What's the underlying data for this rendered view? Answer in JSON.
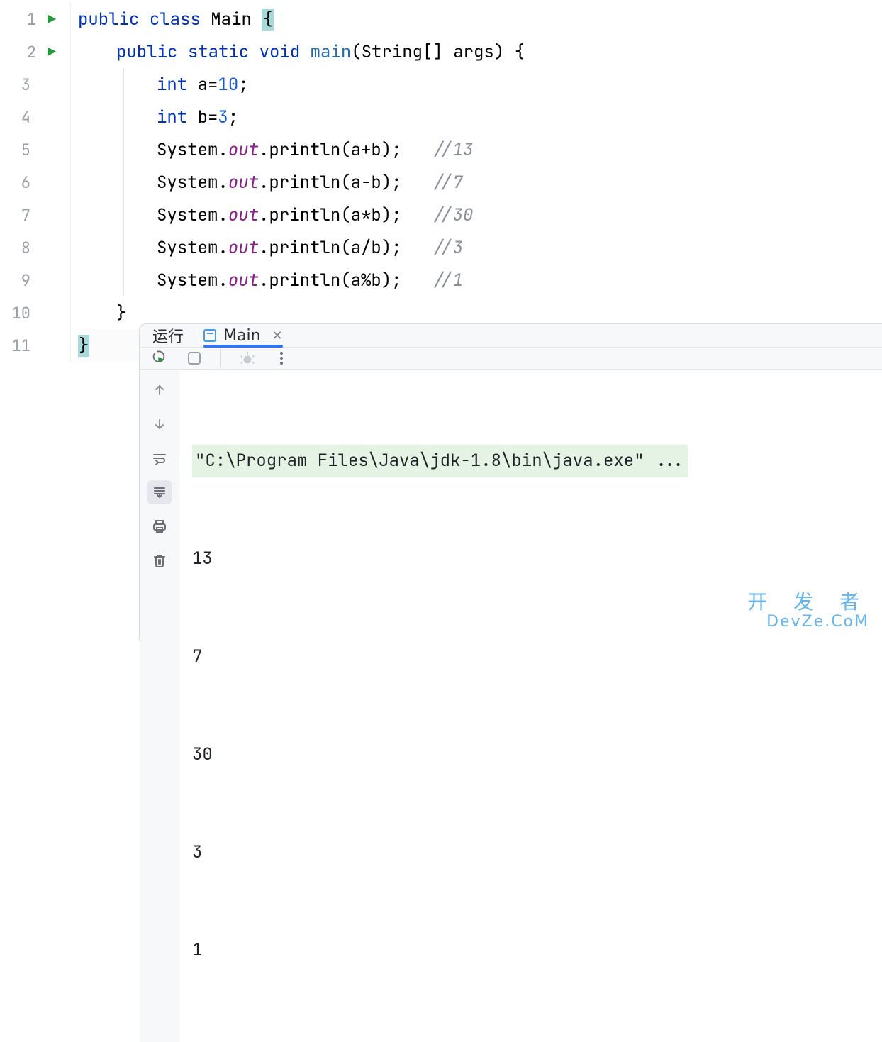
{
  "gutter": {
    "lines": [
      "1",
      "2",
      "3",
      "4",
      "5",
      "6",
      "7",
      "8",
      "9",
      "10",
      "11"
    ],
    "run_markers": [
      true,
      true,
      false,
      false,
      false,
      false,
      false,
      false,
      false,
      false,
      false
    ]
  },
  "code": {
    "l1_public": "public ",
    "l1_class": "class ",
    "l1_Main": "Main ",
    "l1_open": "{",
    "l2_public": "public ",
    "l2_static": "static ",
    "l2_void": "void ",
    "l2_main": "main",
    "l2_sig": "(String[] args) {",
    "l3_int": "int ",
    "l3_rest": "a=",
    "l3_val": "10",
    "l3_semi": ";",
    "l4_int": "int ",
    "l4_rest": "b=",
    "l4_val": "3",
    "l4_semi": ";",
    "sys": "System.",
    "out": "out",
    "dot": ".",
    "println": "println",
    "l5_arg": "(a+b);",
    "l5_cmt": "//13",
    "l6_arg": "(a-b);",
    "l6_cmt": "//7",
    "l7_arg": "(a*b);",
    "l7_cmt": "//30",
    "l8_arg": "(a/b);",
    "l8_cmt": "//3",
    "l9_arg": "(a%b);",
    "l9_cmt": "//1",
    "l10": "}",
    "l11": "}"
  },
  "run": {
    "title": "运行",
    "tab_label": "Main",
    "cmd": "\"C:\\Program Files\\Java\\jdk-1.8\\bin\\java.exe\" ...",
    "out": [
      "13",
      "7",
      "30",
      "3",
      "1"
    ]
  },
  "watermark": {
    "line1": "开 发 者",
    "line2": "DevZe.CoM"
  }
}
